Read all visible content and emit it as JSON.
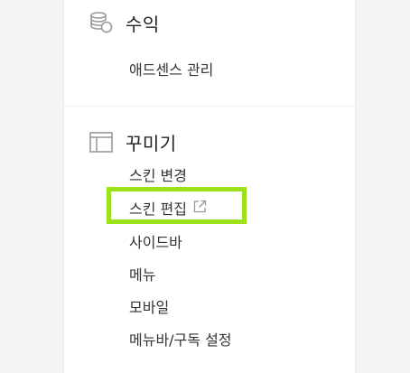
{
  "sections": {
    "revenue": {
      "title": "수익",
      "icon": "coins-icon",
      "items": [
        "애드센스 관리"
      ]
    },
    "decorate": {
      "title": "꾸미기",
      "icon": "layout-icon",
      "items": [
        "스킨 변경",
        "스킨 편집",
        "사이드바",
        "메뉴",
        "모바일",
        "메뉴바/구독 설정"
      ]
    }
  },
  "highlighted_item": "스킨 편집",
  "highlighted_item_icon": "external-link-icon",
  "colors": {
    "highlight_border": "#9be21a",
    "text": "#333333",
    "icon": "#999999"
  }
}
